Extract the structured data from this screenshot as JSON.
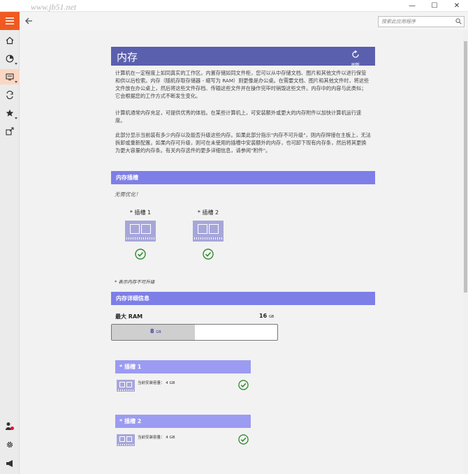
{
  "titlebar": {
    "watermark": "www.jb51.net",
    "minimize": "—",
    "maximize": "☐",
    "close": "✕"
  },
  "navbar": {
    "search_placeholder": "搜索此应用程序"
  },
  "leftbar": {
    "items": [
      "home-icon",
      "dashboard-icon",
      "hardware-icon",
      "sync-icon",
      "favorites-icon",
      "export-icon"
    ],
    "bottom_items": [
      "user-alert-icon",
      "settings-icon",
      "announce-icon"
    ]
  },
  "header": {
    "title": "内存",
    "refresh_label": "刷新"
  },
  "intro": {
    "p1": "计算机在一定程度上如同真实的工作区。内置存储如同文件柜，您可以从中存储文档、图片和其他文件以进行保管和供以后检索。内存（随机存取存储器 - 缩写为 RAM）则更像是办公桌。在需要文档、图片和其他文件时，将这些文件放在办公桌上，然后将这些文件存档、传输这些文件并在操作完毕时销毁这些文件。内存中的内容与此类似；它会根据您的工作方式不断发生变化。",
    "p2": "计算机通常内存充足，可提供优秀的体验。在某些计算机上，可安装额外或更大的内存附件以加快计算机运行速度。",
    "p3": "此部分显示当前装有多少内存以及能否升级这些内存。如果此部分指示\"内存不可升级\"，则内存焊接在主板上，无法拆卸或重新配置。如果内存可升级，则可在未使用的插槽中安装额外的内存，也可卸下现有内存条，然后将其更换为更大容量的内存条。有关内存选件的更多详细信息，请参阅\"附件\"。"
  },
  "slots_section": {
    "title": "内存插槽",
    "status": "无需优化！",
    "slots": [
      {
        "label": "* 插槽 1"
      },
      {
        "label": "* 插槽 2"
      }
    ],
    "footnote": "* 表示内存不可升级"
  },
  "details_section": {
    "title": "内存详细信息",
    "max_ram_label": "最大 RAM",
    "max_ram_value": "16",
    "max_ram_unit": "GB",
    "installed_value": "8",
    "installed_unit": "GB",
    "installed_fraction": 0.5,
    "cards": [
      {
        "title": "* 插槽 1",
        "capacity_text": "当前安装容量： 4 GB"
      },
      {
        "title": "* 插槽 2",
        "capacity_text": "当前安装容量： 4 GB"
      }
    ]
  },
  "colors": {
    "accent": "#f05a22",
    "header": "#5a5fae",
    "section": "#7e7ee8",
    "card": "#9b9bf2",
    "check": "#2e8b2e"
  }
}
